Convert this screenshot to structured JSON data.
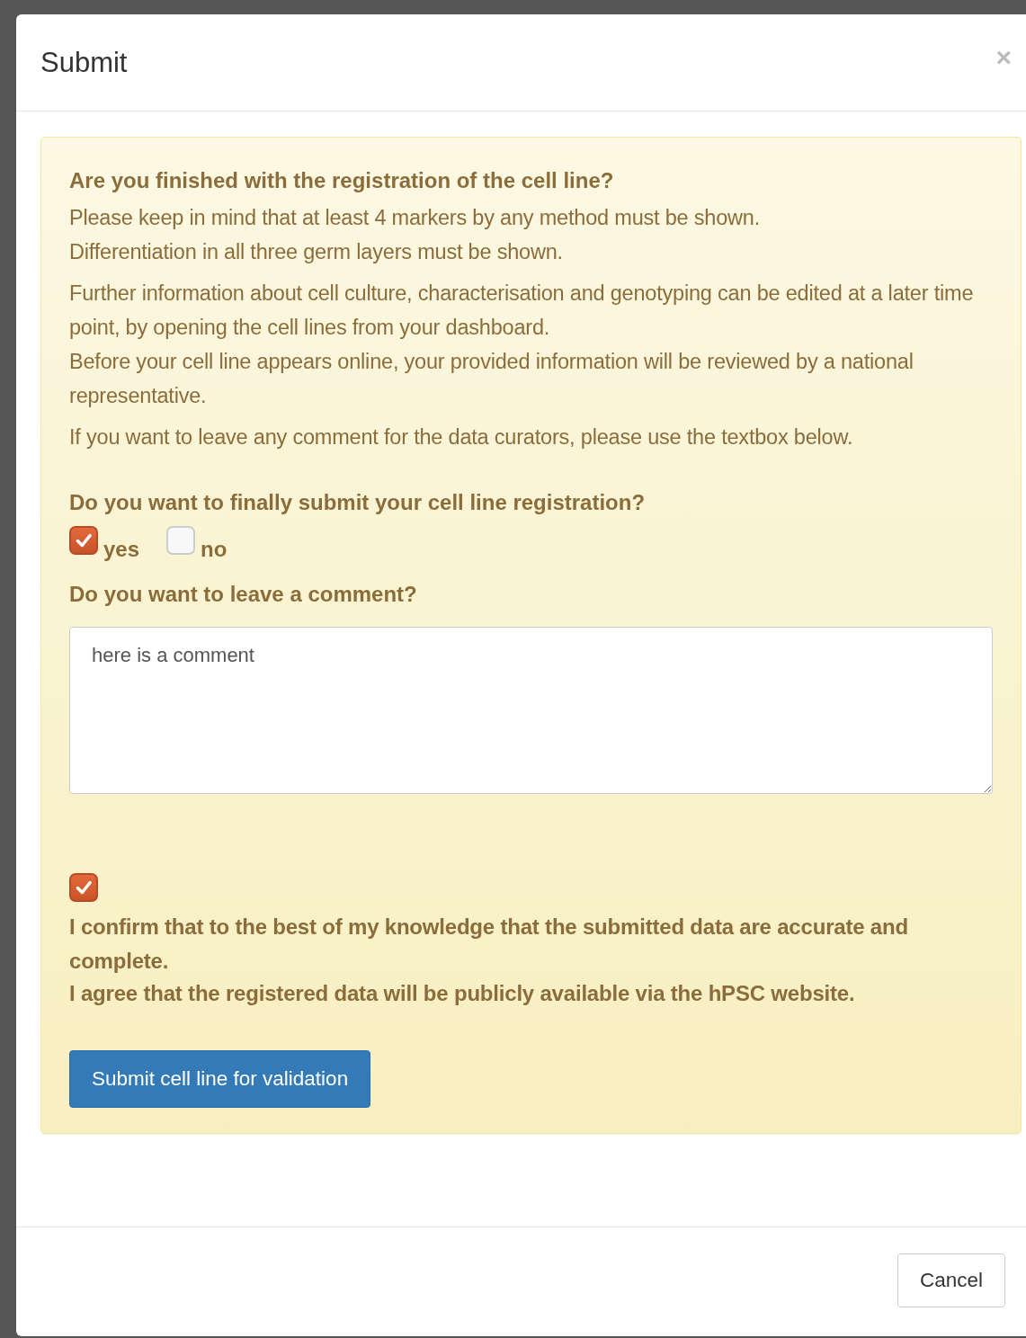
{
  "dialog": {
    "title": "Submit",
    "close": "×"
  },
  "alert": {
    "heading": "Are you finished with the registration of the cell line?",
    "paragraphs": [
      [
        "Please keep in mind that at least 4 markers by any method must be shown.",
        "Differentiation in all three germ layers must be shown."
      ],
      [
        "Further information about cell culture, characterisation and genotyping can be edited at a later time point, by opening the cell lines from your dashboard.",
        "Before your cell line appears online, your provided information will be reviewed by a national representative."
      ],
      [
        "If you want to leave any comment for the data curators, please use the textbox below."
      ]
    ],
    "question": "Do you want to finally submit your cell line registration?",
    "options": [
      {
        "label": "yes",
        "checked": true
      },
      {
        "label": "no",
        "checked": false
      }
    ],
    "comment_label": "Do you want to leave a comment?",
    "comment": {
      "value": "here is a comment"
    },
    "confirm": {
      "checked": true,
      "lines": [
        "I confirm that to the best of my knowledge that the submitted data are accurate and complete.",
        "I agree that the registered data will be publicly available via the hPSC website."
      ]
    },
    "submit_button": "Submit cell line for validation"
  },
  "footer": {
    "cancel_button": "Cancel"
  }
}
